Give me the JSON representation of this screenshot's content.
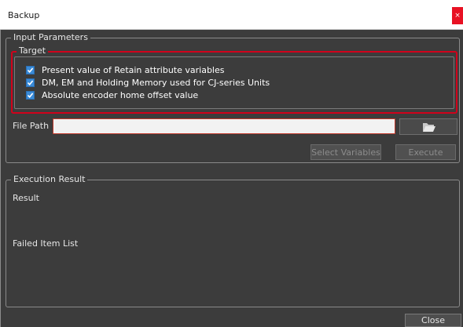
{
  "window": {
    "title": "Backup",
    "close_glyph": "×"
  },
  "input_parameters": {
    "legend": "Input Parameters",
    "target": {
      "legend": "Target",
      "highlight_color": "#d0021b",
      "checkbox_color": "#3a8bd8",
      "options": [
        {
          "label": "Present value of Retain attribute variables",
          "checked": true
        },
        {
          "label": "DM, EM and Holding Memory used for CJ-series Units",
          "checked": true
        },
        {
          "label": "Absolute encoder home offset value",
          "checked": true
        }
      ]
    },
    "file_path": {
      "label": "File Path",
      "value": "",
      "placeholder": "",
      "browse_icon": "folder-icon"
    },
    "select_variables_label": "Select Variables",
    "execute_label": "Execute"
  },
  "execution_result": {
    "legend": "Execution Result",
    "result_label": "Result",
    "failed_item_list_label": "Failed Item List"
  },
  "footer": {
    "close_label": "Close"
  }
}
